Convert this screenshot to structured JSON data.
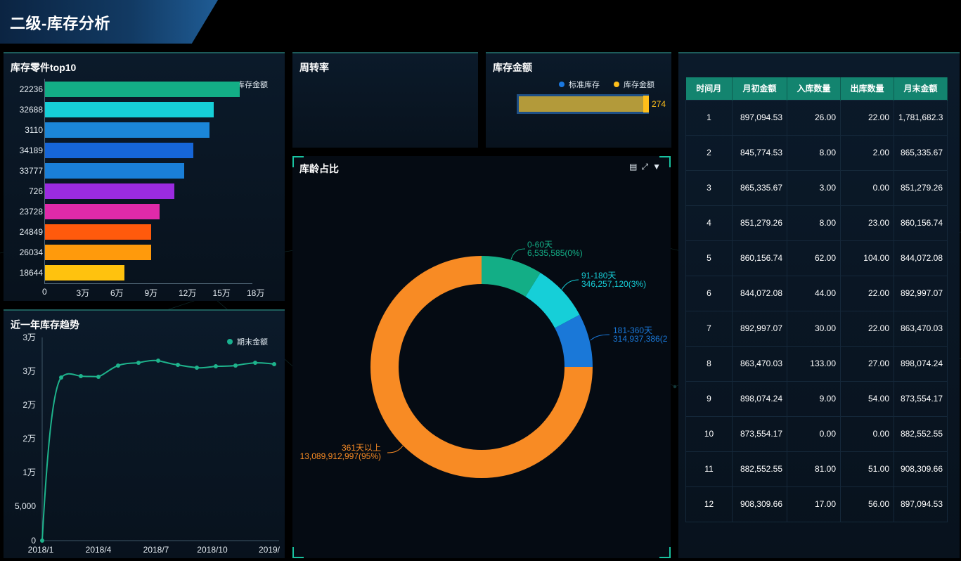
{
  "header": {
    "title": "二级-库存分析"
  },
  "top10": {
    "title": "库存零件top10",
    "legend": "库存金额",
    "color": "#19b08f",
    "items": [
      {
        "label": "22236",
        "value": 172000,
        "color": "#13ae86"
      },
      {
        "label": "32688",
        "value": 149000,
        "color": "#16cfd8"
      },
      {
        "label": "3110",
        "value": 145000,
        "color": "#1b86d8"
      },
      {
        "label": "34189",
        "value": 131000,
        "color": "#1666d8"
      },
      {
        "label": "33777",
        "value": 123000,
        "color": "#1a7fd8"
      },
      {
        "label": "726",
        "value": 114000,
        "color": "#9b2be0"
      },
      {
        "label": "23728",
        "value": 101000,
        "color": "#e02aa9"
      },
      {
        "label": "24849",
        "value": 94000,
        "color": "#ff5a0c"
      },
      {
        "label": "26034",
        "value": 94000,
        "color": "#ff9a0c"
      },
      {
        "label": "18644",
        "value": 70000,
        "color": "#ffc20e"
      }
    ],
    "xticks": [
      "0",
      "3万",
      "6万",
      "9万",
      "12万",
      "15万",
      "18万"
    ],
    "xmax": 180000
  },
  "trend": {
    "title": "近一年库存趋势",
    "legend": "期末金额",
    "yticks": [
      "0",
      "5,000",
      "1万",
      "2万",
      "2万",
      "3万",
      "3万"
    ],
    "xticks": [
      "2018/1",
      "2018/4",
      "2018/7",
      "2018/10",
      "2019/"
    ]
  },
  "turnover": {
    "title": "周转率"
  },
  "amount": {
    "title": "库存金额",
    "legend_standard": "标准库存",
    "legend_stock": "库存金额",
    "value_label": "274",
    "standard_color": "#1a78e0",
    "stock_color": "#ffbf1a"
  },
  "age": {
    "title": "库龄占比",
    "slices": [
      {
        "name": "0-60天",
        "value_label": "6,535,585(0%)",
        "color": "#13ae86"
      },
      {
        "name": "91-180天",
        "value_label": "346,257,120(3%)",
        "color": "#16cfd8"
      },
      {
        "name": "181-360天",
        "value_label": "314,937,386(2",
        "color": "#1a78d8"
      },
      {
        "name": "361天以上",
        "value_label": "13,089,912,997(95%)",
        "color": "#f88b24"
      }
    ]
  },
  "table": {
    "headers": [
      "时间月",
      "月初金额",
      "入库数量",
      "出库数量",
      "月末金额"
    ],
    "rows": [
      [
        "1",
        "897,094.53",
        "26.00",
        "22.00",
        "1,781,682.3"
      ],
      [
        "2",
        "845,774.53",
        "8.00",
        "2.00",
        "865,335.67"
      ],
      [
        "3",
        "865,335.67",
        "3.00",
        "0.00",
        "851,279.26"
      ],
      [
        "4",
        "851,279.26",
        "8.00",
        "23.00",
        "860,156.74"
      ],
      [
        "5",
        "860,156.74",
        "62.00",
        "104.00",
        "844,072.08"
      ],
      [
        "6",
        "844,072.08",
        "44.00",
        "22.00",
        "892,997.07"
      ],
      [
        "7",
        "892,997.07",
        "30.00",
        "22.00",
        "863,470.03"
      ],
      [
        "8",
        "863,470.03",
        "133.00",
        "27.00",
        "898,074.24"
      ],
      [
        "9",
        "898,074.24",
        "9.00",
        "54.00",
        "873,554.17"
      ],
      [
        "10",
        "873,554.17",
        "0.00",
        "0.00",
        "882,552.55"
      ],
      [
        "11",
        "882,552.55",
        "81.00",
        "51.00",
        "908,309.66"
      ],
      [
        "12",
        "908,309.66",
        "17.00",
        "56.00",
        "897,094.53"
      ]
    ]
  }
}
